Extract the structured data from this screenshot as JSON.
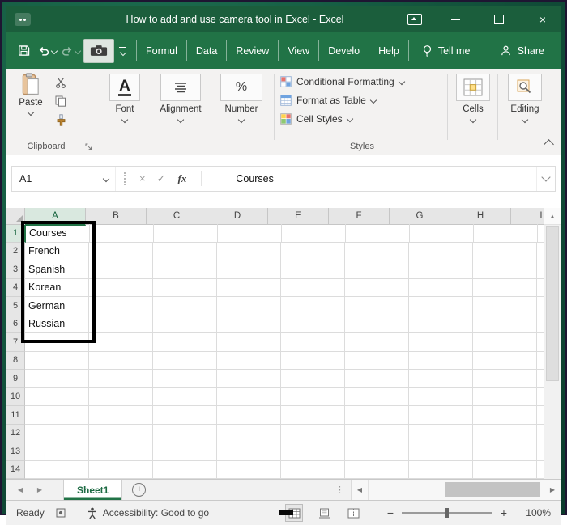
{
  "colors": {
    "excel_green": "#217346",
    "titlebar_green": "#1b5e3c",
    "annotation_black": "#000000"
  },
  "titlebar": {
    "title": "How to add and use camera tool in Excel - Excel",
    "close_glyph": "×"
  },
  "tabs": [
    "Formul",
    "Data",
    "Review",
    "View",
    "Develo",
    "Help"
  ],
  "tell_me_label": "Tell me",
  "share_label": "Share",
  "ribbon": {
    "paste_label": "Paste",
    "font_icon": "A",
    "font_label": "Font",
    "alignment_label": "Alignment",
    "number_icon": "%",
    "number_label": "Number",
    "styles_items": [
      "Conditional Formatting",
      "Format as Table",
      "Cell Styles"
    ],
    "cells_label": "Cells",
    "editing_label": "Editing",
    "group_labels": {
      "clipboard": "Clipboard",
      "styles": "Styles"
    }
  },
  "formula_bar": {
    "name_box": "A1",
    "cancel": "×",
    "enter": "✓",
    "fx_label": "fx",
    "value": "Courses"
  },
  "grid": {
    "columns": [
      "A",
      "B",
      "C",
      "D",
      "E",
      "F",
      "G",
      "H",
      "I"
    ],
    "row_count": 14,
    "selected_column": "A",
    "selected_row": 1,
    "cells": {
      "A1": "Courses",
      "A2": "French",
      "A3": "Spanish",
      "A4": "Korean",
      "A5": "German",
      "A6": "Russian"
    }
  },
  "sheet_bar": {
    "active_sheet": "Sheet1",
    "new_sheet_glyph": "+"
  },
  "status_bar": {
    "mode": "Ready",
    "accessibility": "Accessibility: Good to go",
    "zoom_out": "−",
    "zoom_in": "+",
    "zoom_level": "100%"
  },
  "glyphs": {
    "scroll_up": "▲",
    "scroll_left": "◀",
    "scroll_right": "▶",
    "nav_left": "◀",
    "nav_right": "▶",
    "dots_vertical": "⋮"
  }
}
